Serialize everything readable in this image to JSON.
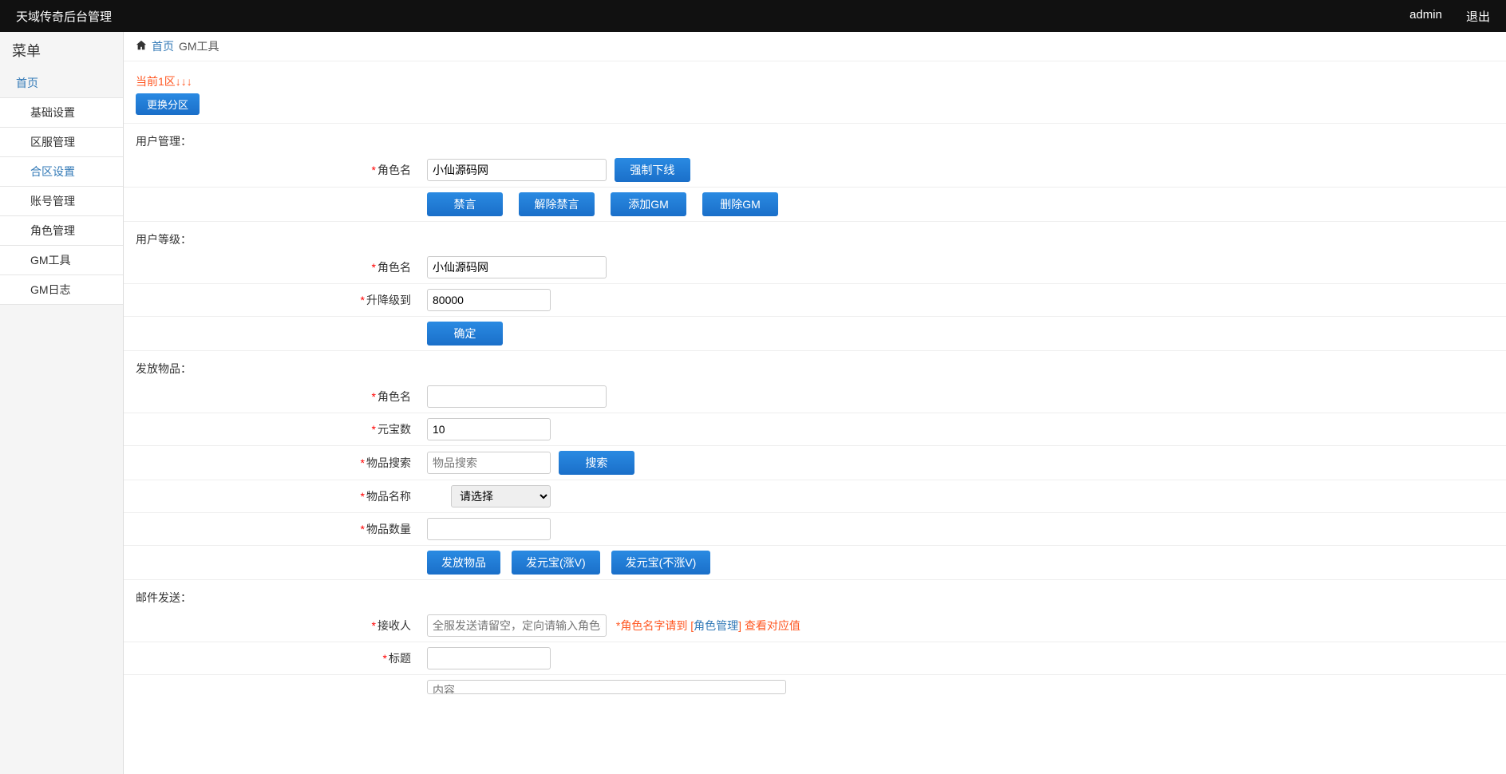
{
  "topbar": {
    "title": "天域传奇后台管理",
    "user": "admin",
    "logout": "退出"
  },
  "sidebar": {
    "title": "菜单",
    "home": "首页",
    "items": [
      "基础设置",
      "区服管理",
      "合区设置",
      "账号管理",
      "角色管理",
      "GM工具",
      "GM日志"
    ],
    "activeIndex": 2
  },
  "breadcrumb": {
    "home": "首页",
    "current": "GM工具"
  },
  "zone": {
    "current": "当前1区↓↓↓",
    "switch_btn": "更换分区"
  },
  "sections": {
    "user_manage": {
      "title": "用户管理：",
      "role_label": "角色名",
      "role_value": "小仙源码网",
      "force_offline": "强制下线",
      "buttons": [
        "禁言",
        "解除禁言",
        "添加GM",
        "删除GM"
      ]
    },
    "user_level": {
      "title": "用户等级：",
      "role_label": "角色名",
      "role_value": "小仙源码网",
      "level_label": "升降级到",
      "level_value": "80000",
      "confirm": "确定"
    },
    "give_item": {
      "title": "发放物品：",
      "role_label": "角色名",
      "yuanbao_label": "元宝数",
      "yuanbao_value": "10",
      "search_label": "物品搜索",
      "search_placeholder": "物品搜索",
      "search_btn": "搜索",
      "item_name_label": "物品名称",
      "item_select_placeholder": "请选择",
      "item_qty_label": "物品数量",
      "buttons": [
        "发放物品",
        "发元宝(涨V)",
        "发元宝(不涨V)"
      ]
    },
    "mail": {
      "title": "邮件发送：",
      "receiver_label": "接收人",
      "receiver_placeholder": "全服发送请留空，定向请输入角色名字",
      "hint_pre": "*角色名字请到 [",
      "hint_link": "角色管理",
      "hint_post": "] 查看对应值",
      "title_label": "标题",
      "content_placeholder": "内容"
    }
  }
}
